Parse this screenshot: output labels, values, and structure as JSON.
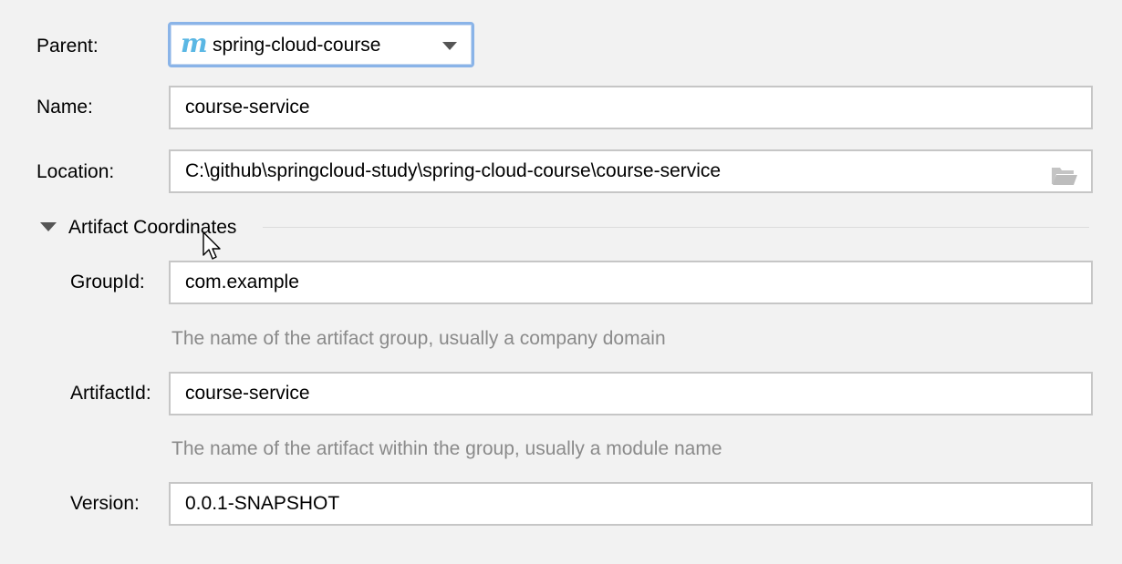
{
  "parent": {
    "label": "Parent:",
    "icon": "maven-m-icon",
    "icon_text": "m",
    "value": "spring-cloud-course"
  },
  "name": {
    "label": "Name:",
    "value": "course-service"
  },
  "location": {
    "label": "Location:",
    "value": "C:\\github\\springcloud-study\\spring-cloud-course\\course-service",
    "icon": "folder-open-icon"
  },
  "artifact_section": {
    "title": "Artifact Coordinates",
    "expanded": true
  },
  "group_id": {
    "label": "GroupId:",
    "value": "com.example",
    "hint": "The name of the artifact group, usually a company domain"
  },
  "artifact_id": {
    "label": "ArtifactId:",
    "value": "course-service",
    "hint": "The name of the artifact within the group, usually a module name"
  },
  "version": {
    "label": "Version:",
    "value": "0.0.1-SNAPSHOT"
  },
  "colors": {
    "background": "#f2f2f2",
    "field_border": "#c6c6c6",
    "focus_border": "#8ab4e8",
    "maven_icon": "#5ab7e4",
    "hint_text": "#8a8a8a"
  }
}
